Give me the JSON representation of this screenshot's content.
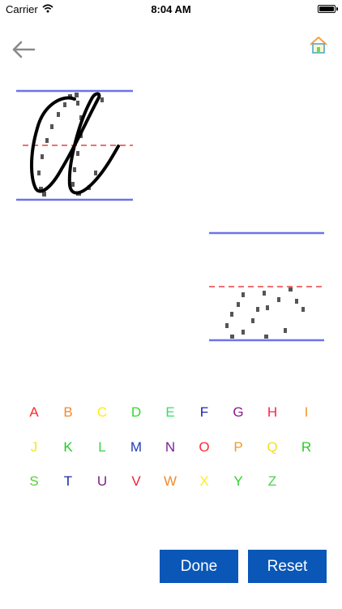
{
  "status_bar": {
    "carrier": "Carrier",
    "time": "8:04 AM",
    "battery_level": 1.0
  },
  "nav": {
    "back_icon": "arrow-left-icon",
    "home_icon": "house-icon"
  },
  "practice": {
    "current_letter": "a",
    "style": "cursive"
  },
  "alphabet": [
    {
      "letter": "A",
      "color": "#ff2a2a"
    },
    {
      "letter": "B",
      "color": "#f08b2c"
    },
    {
      "letter": "C",
      "color": "#ffee00"
    },
    {
      "letter": "D",
      "color": "#2ddc29"
    },
    {
      "letter": "E",
      "color": "#36e06a"
    },
    {
      "letter": "F",
      "color": "#1922b0"
    },
    {
      "letter": "G",
      "color": "#8a1a8c"
    },
    {
      "letter": "H",
      "color": "#ff1e4c"
    },
    {
      "letter": "I",
      "color": "#f29a2e"
    },
    {
      "letter": "J",
      "color": "#f2e626"
    },
    {
      "letter": "K",
      "color": "#22cc22"
    },
    {
      "letter": "L",
      "color": "#3ad24a"
    },
    {
      "letter": "M",
      "color": "#1f3bb8"
    },
    {
      "letter": "N",
      "color": "#7a2095"
    },
    {
      "letter": "O",
      "color": "#ff2a36"
    },
    {
      "letter": "P",
      "color": "#f2982c"
    },
    {
      "letter": "Q",
      "color": "#f3df26"
    },
    {
      "letter": "R",
      "color": "#28cc24"
    },
    {
      "letter": "S",
      "color": "#56cf3a"
    },
    {
      "letter": "T",
      "color": "#1a2aa4"
    },
    {
      "letter": "U",
      "color": "#7a1f7e"
    },
    {
      "letter": "V",
      "color": "#e8243a"
    },
    {
      "letter": "W",
      "color": "#ee8c2e"
    },
    {
      "letter": "X",
      "color": "#ffee1a"
    },
    {
      "letter": "Y",
      "color": "#2ed42a"
    },
    {
      "letter": "Z",
      "color": "#52cf4a"
    }
  ],
  "buttons": {
    "done": "Done",
    "reset": "Reset"
  },
  "colors": {
    "guide_line": "#6d73e8",
    "mid_line": "#f07070",
    "button": "#0a57b7",
    "ink": "#000000",
    "trace_dots": "#555555"
  }
}
